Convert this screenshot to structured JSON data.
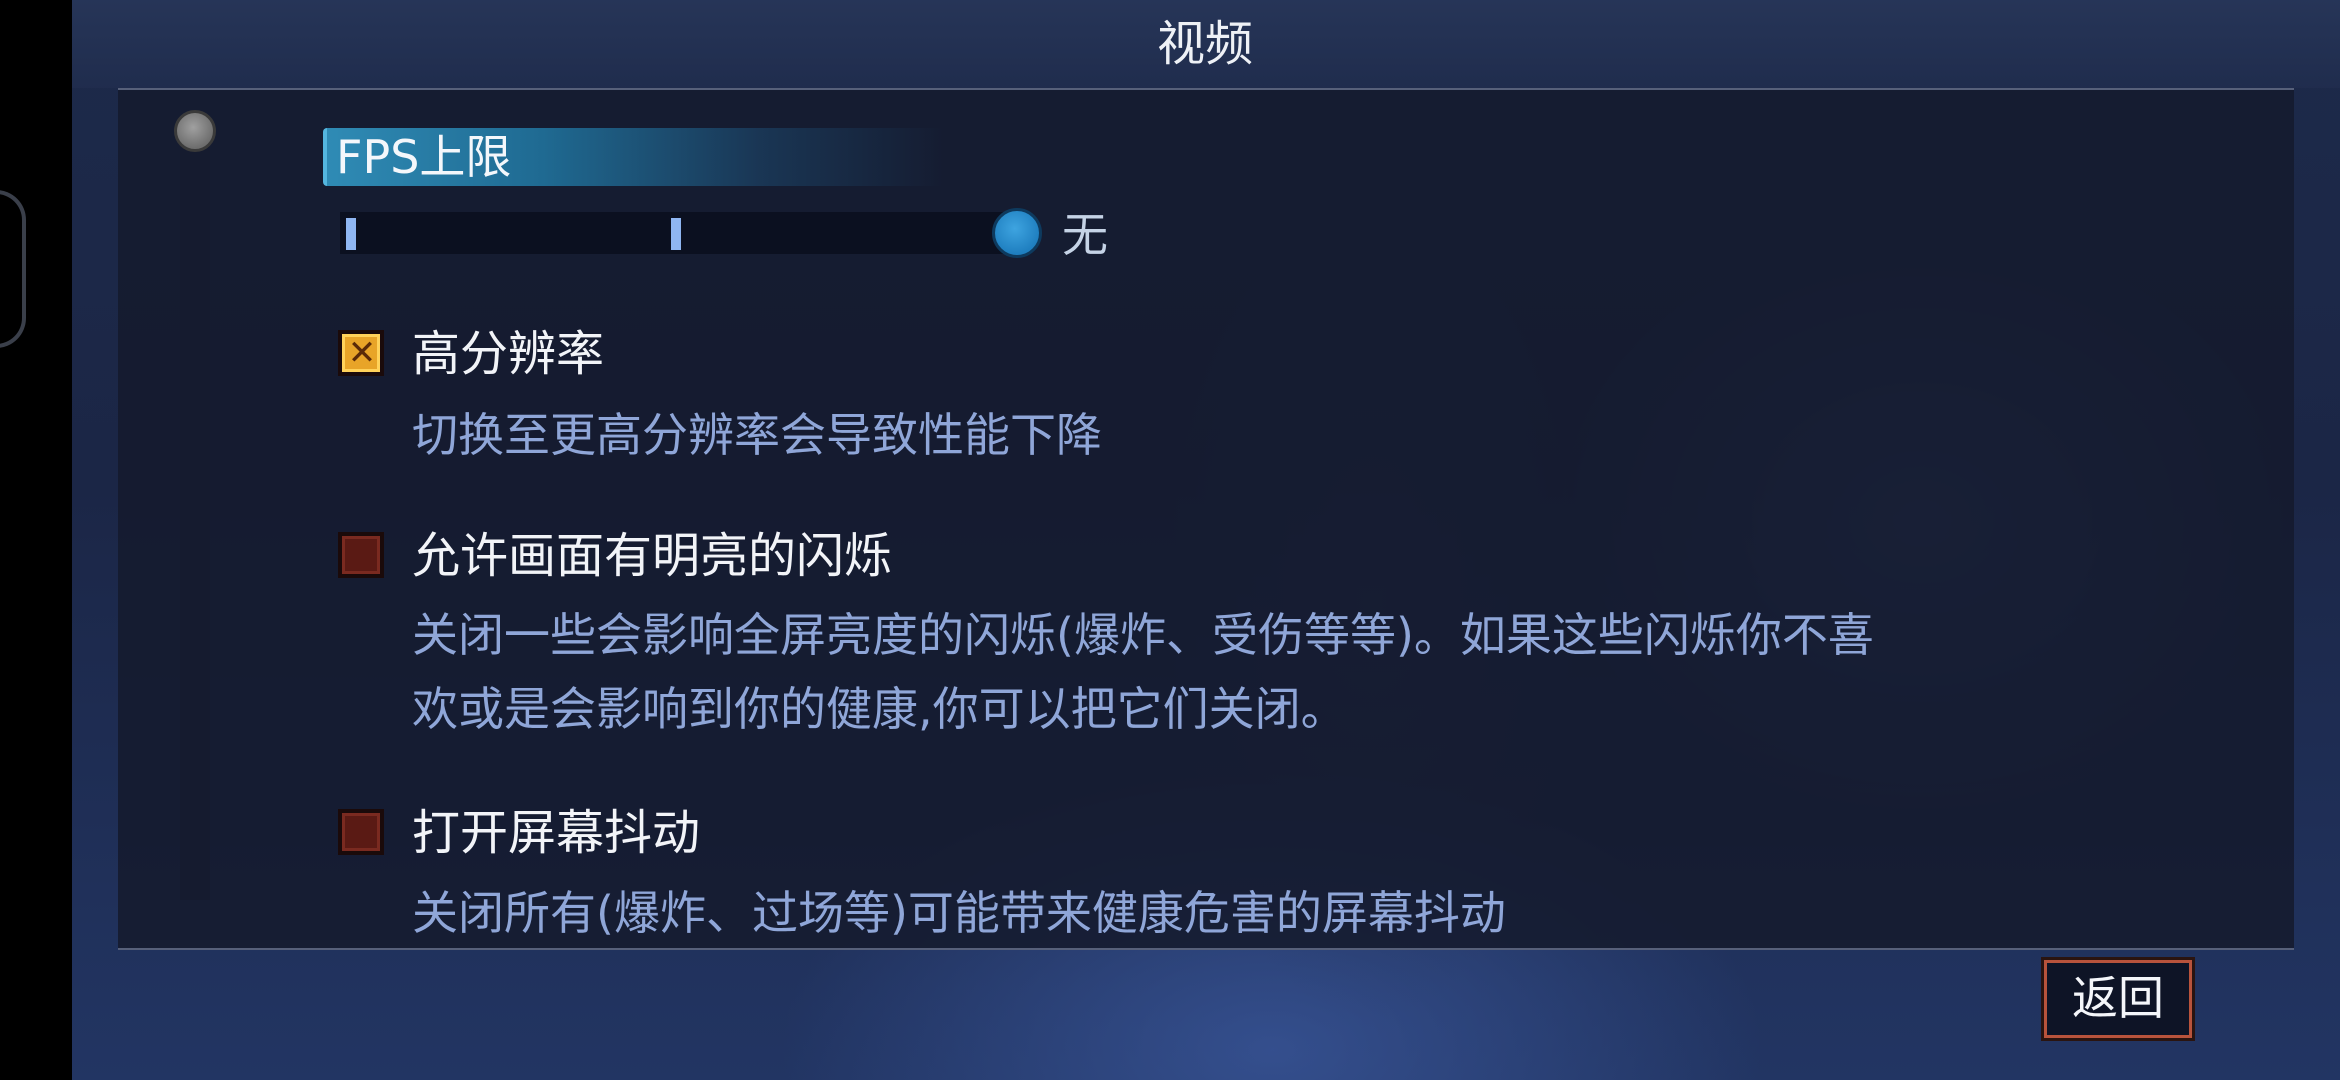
{
  "header": {
    "title": "视频"
  },
  "fps_limit": {
    "label": "FPS上限",
    "value_label": "无",
    "position": 1.0,
    "steps": 3
  },
  "options": [
    {
      "title": "高分辨率",
      "checked": true,
      "description_lines": [
        "切换至更高分辨率会导致性能下降"
      ]
    },
    {
      "title": "允许画面有明亮的闪烁",
      "checked": false,
      "description_lines": [
        "关闭一些会影响全屏亮度的闪烁(爆炸、受伤等等)。如果这些闪烁你不喜",
        "欢或是会影响到你的健康,你可以把它们关闭。"
      ]
    },
    {
      "title": "打开屏幕抖动",
      "checked": false,
      "description_lines": [
        "关闭所有(爆炸、过场等)可能带来健康危害的屏幕抖动"
      ]
    }
  ],
  "footer": {
    "back_label": "返回"
  },
  "colors": {
    "accent_blue": "#2f8bb5",
    "checkbox_on": "#e8a428",
    "checkbox_off": "#5a1a14",
    "desc_text": "#8fa6d8",
    "back_border": "#b8533c"
  }
}
